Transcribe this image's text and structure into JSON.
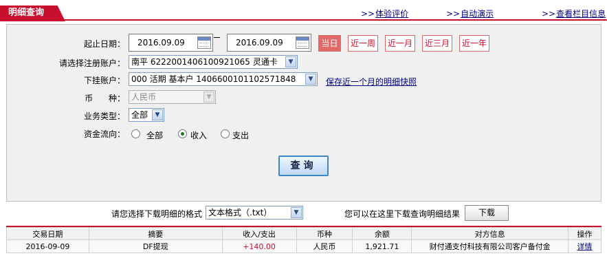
{
  "header": {
    "tab_title": "明细查询",
    "links": [
      {
        "arrow": ">>",
        "label": "体验评价"
      },
      {
        "arrow": ">>",
        "label": "自动演示"
      },
      {
        "arrow": ">>",
        "label": "查看栏目信息"
      }
    ]
  },
  "form": {
    "date_label": "起止日期：",
    "start_date": "2016.09.09",
    "end_date": "2016.09.09",
    "quick_ranges": [
      "当日",
      "近一周",
      "近一月",
      "近三月",
      "近一年"
    ],
    "selected_range": "当日",
    "account_label": "请选择注册账户：",
    "account_value": "南平  6222001406100921065  灵通卡",
    "sub_account_label": "下挂账户：",
    "sub_account_value": "000  活期  基本户  1406600101102571848",
    "save_snapshot_link": "保存近一个月的明细快照",
    "currency_label": "币      种：",
    "currency_value": "人民币",
    "biz_type_label": "业务类型：",
    "biz_type_value": "全部",
    "flow_label": "资金流向：",
    "flow_options": [
      "全部",
      "收入",
      "支出"
    ],
    "flow_selected": "收入",
    "search_button": "查询"
  },
  "download": {
    "format_label": "请您选择下载明细的格式",
    "format_value": "文本格式（.txt）",
    "hint": "您可以在这里下载查询明细结果",
    "button": "下载"
  },
  "table": {
    "columns": [
      "交易日期",
      "摘要",
      "收入/支出",
      "币种",
      "余额",
      "对方信息",
      "操作"
    ],
    "rows": [
      [
        "2016-09-09",
        "DF提现",
        "+140.00",
        "人民币",
        "1,921.71",
        "财付通支付科技有限公司客户备付金",
        "详情"
      ]
    ]
  },
  "colors": {
    "accent": "#c8102e",
    "link": "#000080",
    "selected_radio": "#1a7a1a"
  }
}
